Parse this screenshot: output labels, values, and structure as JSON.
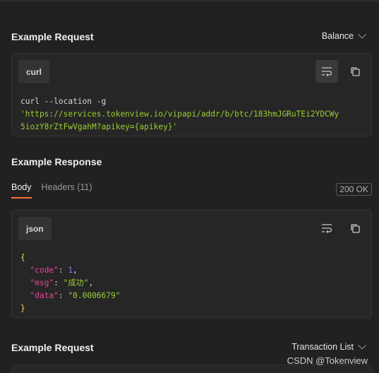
{
  "sections": [
    {
      "title": "Example Request",
      "selector": "Balance",
      "lang": "curl",
      "code_lines": [
        "curl --location -g",
        "'https://services.tokenview.io/vipapi/addr/b/btc/183hmJGRuTEi2YDCWy",
        "5iozY8rZtFwVgahM?apikey={apikey}'"
      ]
    },
    {
      "title": "Example Response",
      "tabs": [
        "Body",
        "Headers (11)"
      ],
      "status": "200 OK",
      "lang": "json",
      "json": {
        "open": "{",
        "code_key": "\"code\"",
        "code_val": "1",
        "msg_key": "\"msg\"",
        "msg_val": "\"成功\"",
        "data_key": "\"data\"",
        "data_val": "\"0.0006679\"",
        "close": "}"
      }
    },
    {
      "title": "Example Request",
      "selector": "Transaction List"
    }
  ],
  "icons": [
    "wrap-lines-icon",
    "copy-icon",
    "chevron-down-icon"
  ],
  "watermark": "CSDN @Tokenview",
  "colors": {
    "accent": "#ff6c37",
    "string": "#9acd32",
    "key": "#e6449a",
    "number": "#6b7cff",
    "brace": "#f2d95c"
  }
}
